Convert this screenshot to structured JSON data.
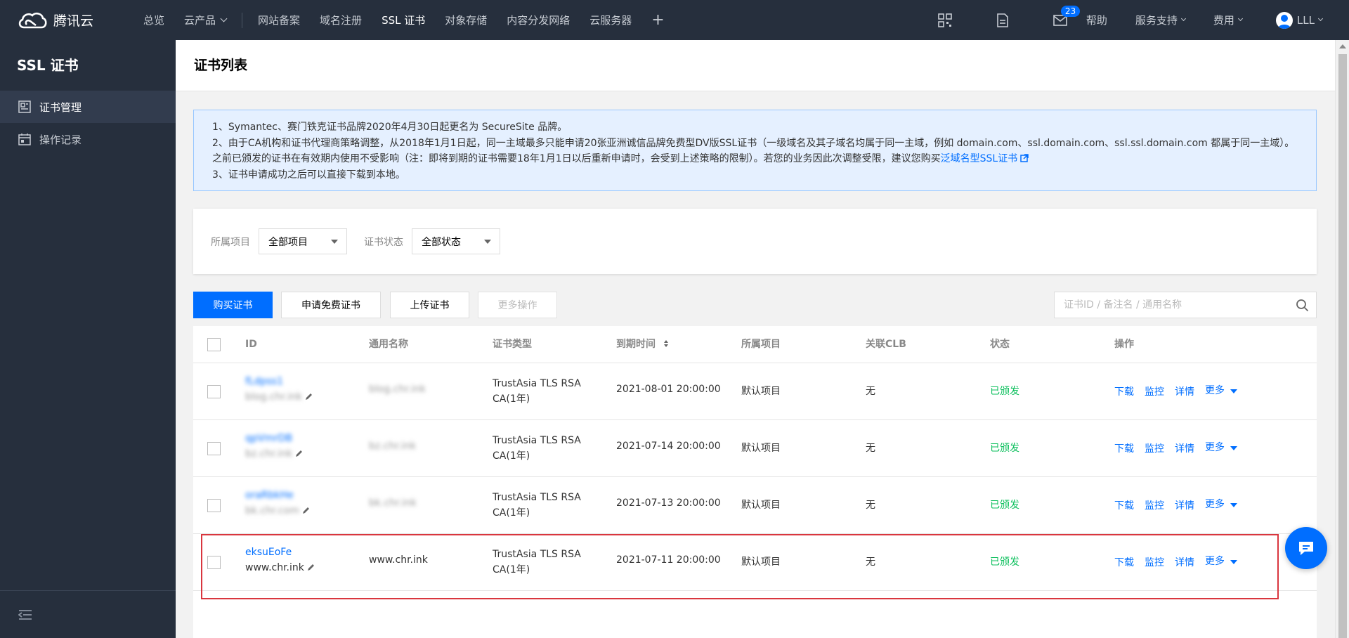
{
  "topbar": {
    "brand": "腾讯云",
    "nav": [
      {
        "label": "总览",
        "caret": false
      },
      {
        "label": "云产品",
        "caret": true
      }
    ],
    "shortcuts": [
      "网站备案",
      "域名注册",
      "SSL 证书",
      "对象存储",
      "内容分发网络",
      "云服务器"
    ],
    "active_shortcut": "SSL 证书",
    "mail_badge": "23",
    "help": "帮助",
    "support": "服务支持",
    "billing": "费用",
    "user": "LLL"
  },
  "sidebar": {
    "title": "SSL 证书",
    "items": [
      {
        "label": "证书管理",
        "icon": "cert-manage-icon",
        "active": true
      },
      {
        "label": "操作记录",
        "icon": "calendar-icon",
        "active": false
      }
    ]
  },
  "page": {
    "title": "证书列表"
  },
  "notice": {
    "line1": "1、Symantec、赛门铁克证书品牌2020年4月30日起更名为 SecureSite 品牌。",
    "line2": "2、由于CA机构和证书代理商策略调整，从2018年1月1日起，同一主域最多只能申请20张亚洲诚信品牌免费型DV版SSL证书（一级域名及其子域名均属于同一主域，例如 domain.com、ssl.domain.com、ssl.ssl.domain.com 都属于同一主域）。之前已颁发的证书在有效期内使用不受影响（注：即将到期的证书需要18年1月1日以后重新申请时，会受到上述策略的限制）。若您的业务因此次调整受限，建议您购买",
    "link": "泛域名型SSL证书",
    "line3": "3、证书申请成功之后可以直接下载到本地。"
  },
  "filters": {
    "project_label": "所属项目",
    "project_value": "全部项目",
    "status_label": "证书状态",
    "status_value": "全部状态"
  },
  "actions": {
    "buy": "购买证书",
    "apply_free": "申请免费证书",
    "upload": "上传证书",
    "more": "更多操作",
    "search_placeholder": "证书ID / 备注名 / 通用名称"
  },
  "table": {
    "headers": {
      "id": "ID",
      "common_name": "通用名称",
      "cert_type": "证书类型",
      "expire": "到期时间",
      "project": "所属项目",
      "clb": "关联CLB",
      "status": "状态",
      "ops": "操作"
    },
    "rows": [
      {
        "id": "fLdpss1",
        "remark": "blog.chr.ink",
        "common_name": "blog.chr.ink",
        "type_line1": "TrustAsia TLS RSA",
        "type_line2": "CA(1年)",
        "expire": "2021-08-01 20:00:00",
        "project": "默认项目",
        "clb": "无",
        "status": "已颁发",
        "blurred": true
      },
      {
        "id": "qpVmrDB",
        "remark": "bz.chr.ink",
        "common_name": "bz.chr.ink",
        "type_line1": "TrustAsia TLS RSA",
        "type_line2": "CA(1年)",
        "expire": "2021-07-14 20:00:00",
        "project": "默认项目",
        "clb": "无",
        "status": "已颁发",
        "blurred": true
      },
      {
        "id": "oraRbkHe",
        "remark": "bk.chr.com",
        "common_name": "bk.chr.ink",
        "type_line1": "TrustAsia TLS RSA",
        "type_line2": "CA(1年)",
        "expire": "2021-07-13 20:00:00",
        "project": "默认项目",
        "clb": "无",
        "status": "已颁发",
        "blurred": true
      },
      {
        "id": "eksuEoFe",
        "remark": "www.chr.ink",
        "common_name": "www.chr.ink",
        "type_line1": "TrustAsia TLS RSA",
        "type_line2": "CA(1年)",
        "expire": "2021-07-11 20:00:00",
        "project": "默认项目",
        "clb": "无",
        "status": "已颁发",
        "blurred": false
      }
    ],
    "ops": {
      "download": "下载",
      "monitor": "监控",
      "detail": "详情",
      "more": "更多"
    }
  },
  "colors": {
    "topbar_bg": "#262f3d",
    "primary": "#006eff",
    "success": "#0abf5b",
    "highlight_border": "#d9363e"
  }
}
